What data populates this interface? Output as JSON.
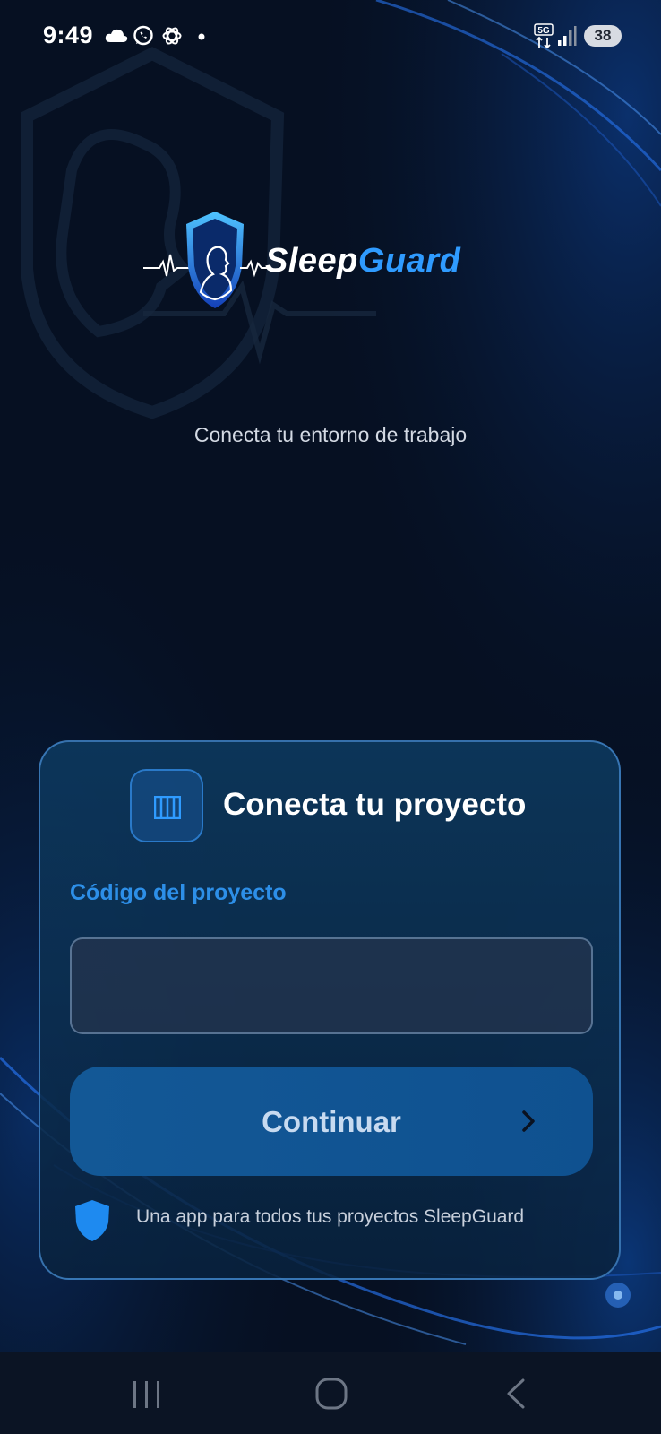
{
  "status_bar": {
    "time": "9:49",
    "network": "5G",
    "battery": "38",
    "icons": [
      "cloud-icon",
      "whatsapp-icon",
      "openai-icon",
      "notification-dot-icon",
      "network-5g-icon",
      "signal-icon"
    ]
  },
  "brand": {
    "name_part1": "Sleep",
    "name_part2": "Guard",
    "logo_icon": "shield-heartbeat-logo"
  },
  "tagline": "Conecta tu entorno de trabajo",
  "card": {
    "icon": "project-grid-icon",
    "title": "Conecta tu proyecto",
    "field_label": "Código del proyecto",
    "input_value": "",
    "continue_label": "Continuar",
    "continue_icon": "chevron-right-icon",
    "footer_icon": "shield-icon",
    "footer_text": "Una app para todos tus proyectos SleepGuard"
  },
  "nav_bar": {
    "buttons": [
      "recents-icon",
      "home-icon",
      "back-icon"
    ]
  },
  "colors": {
    "background": "#061022",
    "accent": "#2f9bff",
    "label": "#2d8fe8",
    "button": "#135896"
  }
}
